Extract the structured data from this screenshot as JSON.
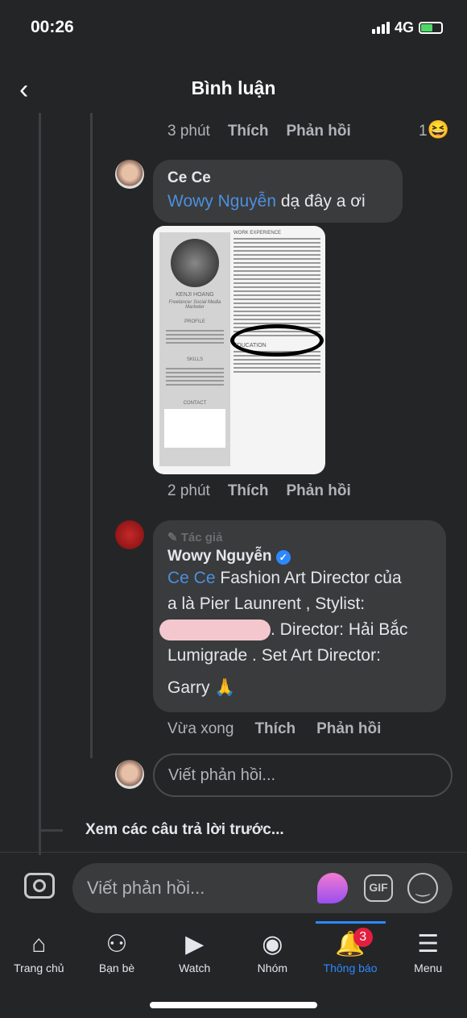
{
  "status": {
    "time": "00:26",
    "network": "4G"
  },
  "header": {
    "title": "Bình luận",
    "back_icon": "chevron-left-icon"
  },
  "prev_meta": {
    "time": "3 phút",
    "like": "Thích",
    "reply": "Phản hồi",
    "reaction_count": "1",
    "reaction": "😆"
  },
  "comment1": {
    "author": "Ce Ce",
    "mention": "Wowy Nguyễn",
    "text": " dạ đây a ơi",
    "image": {
      "work": "WORK EXPERIENCE",
      "name": "KENJI HOANG",
      "role": "Freelancer Social Media Marketer",
      "profile": "PROFILE",
      "skills": "SKILLS",
      "contact": "CONTACT",
      "education": "EDUCATION"
    },
    "time": "2 phút",
    "like": "Thích",
    "reply": "Phản hồi"
  },
  "comment2": {
    "badge": "Tác giả",
    "author": "Wowy Nguyễn",
    "mention": "Ce Ce",
    "lines": [
      " Fashion Art Director của",
      "a là Pier Launrent , Stylist:",
      ". Director: Hải Bắc",
      "Lumigrade . Set Art Director:",
      "Garry 🙏"
    ],
    "time": "Vừa xong",
    "like": "Thích",
    "reply": "Phản hồi"
  },
  "reply_box": {
    "placeholder": "Viết phản hồi..."
  },
  "view_previous": "Xem các câu trả lời trước...",
  "composer": {
    "placeholder": "Viết phản hồi...",
    "gif": "GIF"
  },
  "nav": {
    "active_color": "#2d88ff",
    "items": [
      {
        "label": "Trang chủ",
        "icon": "home-icon"
      },
      {
        "label": "Bạn bè",
        "icon": "friends-icon"
      },
      {
        "label": "Watch",
        "icon": "watch-icon"
      },
      {
        "label": "Nhóm",
        "icon": "groups-icon"
      },
      {
        "label": "Thông báo",
        "icon": "bell-icon",
        "badge": "3"
      },
      {
        "label": "Menu",
        "icon": "menu-icon"
      }
    ]
  }
}
